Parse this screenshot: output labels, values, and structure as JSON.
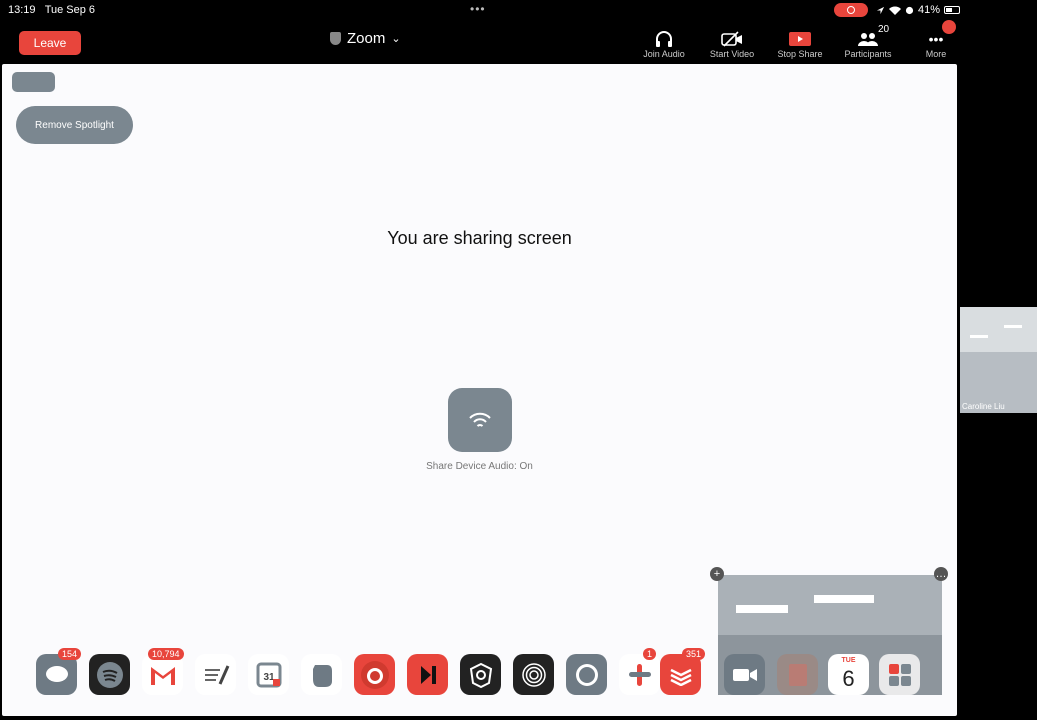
{
  "status_bar": {
    "time": "13:19",
    "date": "Tue Sep 6",
    "battery": "41%"
  },
  "header": {
    "leave_label": "Leave",
    "app_title": "Zoom",
    "toolbar": [
      {
        "label": "Join Audio",
        "icon": "headphones-icon"
      },
      {
        "label": "Start Video",
        "icon": "video-off-icon"
      },
      {
        "label": "Stop Share",
        "icon": "share-screen-icon"
      },
      {
        "label": "Participants",
        "icon": "participants-icon",
        "count": "20"
      },
      {
        "label": "More",
        "icon": "more-icon"
      }
    ]
  },
  "main": {
    "remove_spotlight_label": "Remove Spotlight",
    "sharing_text": "You are sharing screen",
    "share_audio_label": "Share Device Audio: On"
  },
  "video_thumb": {
    "name": "Caroline Liu"
  },
  "dock": {
    "apps": [
      {
        "name": "Messages",
        "badge": "154",
        "color": "#6e7a84"
      },
      {
        "name": "Spotify",
        "badge": "",
        "color": "#222222"
      },
      {
        "name": "Gmail",
        "badge": "10,794",
        "color": "#ffffff"
      },
      {
        "name": "Notes",
        "badge": "",
        "color": "#ffffff"
      },
      {
        "name": "Google Calendar",
        "badge": "",
        "color": "#ffffff"
      },
      {
        "name": "Evernote",
        "badge": "",
        "color": "#ffffff"
      },
      {
        "name": "Firefox",
        "badge": "",
        "color": "#e8453c"
      },
      {
        "name": "Infuse",
        "badge": "",
        "color": "#e8453c"
      },
      {
        "name": "ProtonVPN",
        "badge": "",
        "color": "#222222"
      },
      {
        "name": "Touch ID",
        "badge": "",
        "color": "#222222"
      },
      {
        "name": "Signal",
        "badge": "",
        "color": "#6e7a84"
      },
      {
        "name": "Slack",
        "badge": "1",
        "color": "#ffffff"
      },
      {
        "name": "Todoist",
        "badge": "351",
        "color": "#e8453c"
      },
      {
        "name": "Zoom",
        "badge": "",
        "color": "#6e7a84"
      },
      {
        "name": "PDF app",
        "badge": "",
        "color": "#9a8a86"
      },
      {
        "name": "Calendar",
        "badge": "",
        "color": "#ffffff"
      },
      {
        "name": "App Library",
        "badge": "",
        "color": "#e9e9ea"
      }
    ],
    "calendar": {
      "day": "TUE",
      "date": "6"
    }
  }
}
